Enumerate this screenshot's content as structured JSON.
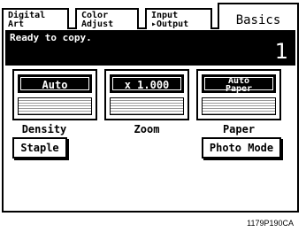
{
  "tabs": [
    {
      "line1": "Digital",
      "line2": "Art"
    },
    {
      "line1": "Color",
      "line2": "Adjust"
    },
    {
      "line1": "Input",
      "line2": "▸Output"
    }
  ],
  "active_tab": "Basics",
  "status": {
    "message": "Ready to copy.",
    "count": "1"
  },
  "controls": {
    "density": {
      "value": "Auto",
      "label": "Density"
    },
    "zoom": {
      "value": "x 1.000",
      "label": "Zoom"
    },
    "paper": {
      "value_line1": "Auto",
      "value_line2": "Paper",
      "label": "Paper"
    }
  },
  "buttons": {
    "staple": "Staple",
    "photo_mode": "Photo Mode"
  },
  "footer_code": "1179P190CA"
}
